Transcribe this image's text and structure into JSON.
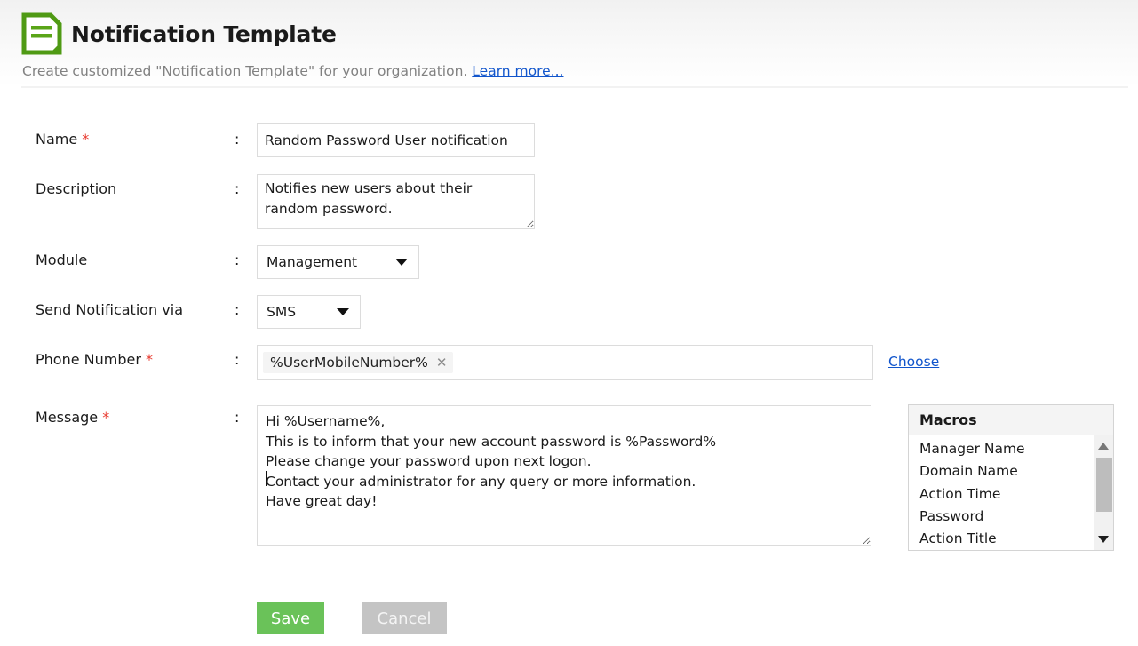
{
  "header": {
    "icon": "document-note-icon",
    "title": "Notification Template",
    "subtitle_before": "Create customized \"Notification Template\" for your organization.",
    "learn_more": "Learn more..."
  },
  "form": {
    "name": {
      "label": "Name",
      "required": "*",
      "colon": ":",
      "value": "Random Password User notification"
    },
    "description": {
      "label": "Description",
      "colon": ":",
      "value": "Notifies new users about their random password."
    },
    "module": {
      "label": "Module",
      "colon": ":",
      "value": "Management"
    },
    "send_via": {
      "label": "Send Notification via",
      "colon": ":",
      "value": "SMS"
    },
    "phone": {
      "label": "Phone Number",
      "required": "*",
      "colon": ":",
      "token": "%UserMobileNumber%",
      "token_remove": "✕",
      "choose_link": "Choose"
    },
    "message": {
      "label": "Message",
      "required": "*",
      "colon": ":",
      "value": "Hi %Username%,\nThis is to inform that your new account password is %Password%\nPlease change your password upon next logon.\nContact your administrator for any query or more information.\nHave great day!"
    }
  },
  "macros": {
    "title": "Macros",
    "items": [
      "Manager Name",
      "Domain Name",
      "Action Time",
      "Password",
      "Action Title"
    ]
  },
  "buttons": {
    "save": "Save",
    "cancel": "Cancel"
  },
  "colors": {
    "save_green": "#6ac259",
    "cancel_gray": "#c4c4c4",
    "link_blue": "#1155cc",
    "required_red": "#e8392e",
    "icon_green": "#4f9a14"
  }
}
